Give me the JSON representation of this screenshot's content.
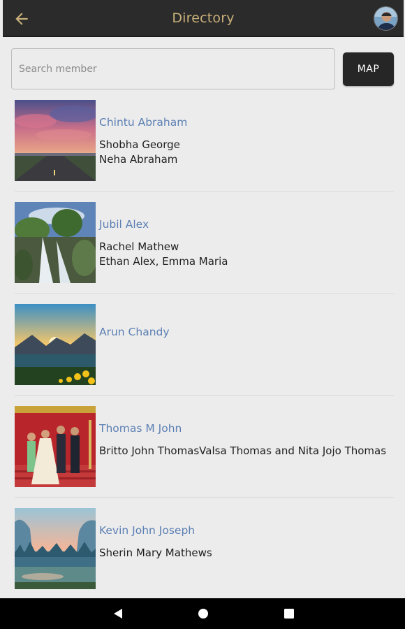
{
  "appbar": {
    "title": "Directory",
    "back_icon": "arrow-back-icon",
    "accent_color": "#c9b07a"
  },
  "search": {
    "placeholder": "Search member",
    "value": ""
  },
  "map_button": {
    "label": "MAP"
  },
  "members": [
    {
      "name": "Chintu Abraham",
      "family": [
        "Shobha George",
        "Neha Abraham"
      ]
    },
    {
      "name": "Jubil Alex",
      "family": [
        "Rachel Mathew",
        "Ethan Alex, Emma Maria"
      ]
    },
    {
      "name": "Arun Chandy",
      "family": []
    },
    {
      "name": "Thomas M John",
      "family": [
        "Britto John ThomasValsa Thomas and Nita Jojo Thomas"
      ]
    },
    {
      "name": "Kevin John Joseph",
      "family": [
        "Sherin Mary Mathews"
      ]
    }
  ],
  "colors": {
    "name_link": "#5b7fb3",
    "appbar_bg": "#2b2b2b",
    "page_bg": "#ececec"
  }
}
